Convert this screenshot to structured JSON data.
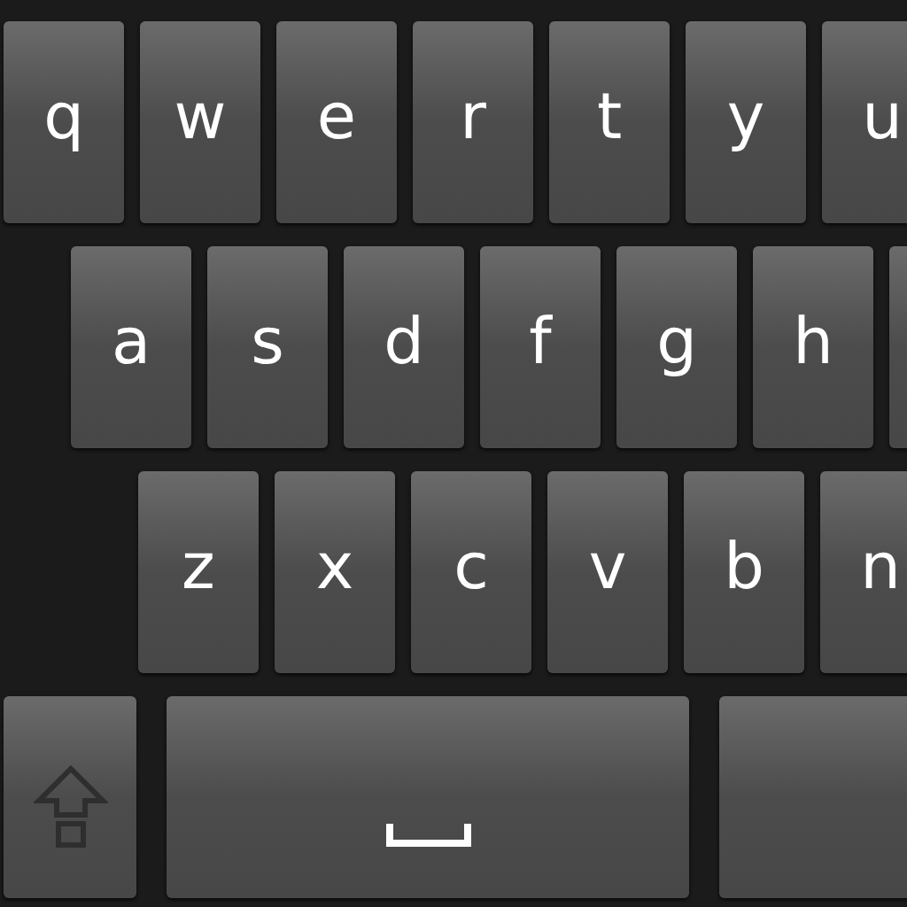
{
  "rows": [
    {
      "keys": [
        {
          "kind": "letter",
          "label": "q"
        },
        {
          "kind": "letter",
          "label": "w"
        },
        {
          "kind": "letter",
          "label": "e"
        },
        {
          "kind": "letter",
          "label": "r"
        },
        {
          "kind": "letter",
          "label": "t"
        },
        {
          "kind": "letter",
          "label": "y"
        },
        {
          "kind": "letter",
          "label": "u"
        }
      ]
    },
    {
      "keys": [
        {
          "kind": "letter",
          "label": "a"
        },
        {
          "kind": "letter",
          "label": "s"
        },
        {
          "kind": "letter",
          "label": "d"
        },
        {
          "kind": "letter",
          "label": "f"
        },
        {
          "kind": "letter",
          "label": "g"
        },
        {
          "kind": "letter",
          "label": "h"
        },
        {
          "kind": "blank"
        }
      ]
    },
    {
      "keys": [
        {
          "kind": "letter",
          "label": "z"
        },
        {
          "kind": "letter",
          "label": "x"
        },
        {
          "kind": "letter",
          "label": "c"
        },
        {
          "kind": "letter",
          "label": "v"
        },
        {
          "kind": "letter",
          "label": "b"
        },
        {
          "kind": "letter",
          "label": "n"
        }
      ]
    },
    {
      "keys": [
        {
          "kind": "shift"
        },
        {
          "kind": "space"
        },
        {
          "kind": "blank"
        }
      ]
    }
  ]
}
